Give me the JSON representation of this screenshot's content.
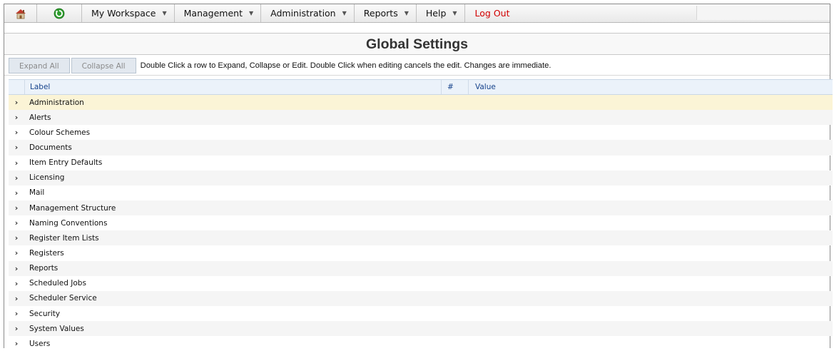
{
  "menubar": {
    "icons": [
      "home-icon",
      "refresh-icon"
    ],
    "items": [
      {
        "label": "My Workspace"
      },
      {
        "label": "Management"
      },
      {
        "label": "Administration"
      },
      {
        "label": "Reports"
      },
      {
        "label": "Help"
      }
    ],
    "logout_label": "Log Out",
    "logout_color": "#d20000",
    "caret_symbol": "▼"
  },
  "page": {
    "title": "Global Settings"
  },
  "toolbar": {
    "expand_all_label": "Expand All",
    "collapse_all_label": "Collapse All",
    "hint": "Double Click a row to Expand, Collapse or Edit. Double Click when editing cancels the edit. Changes are immediate."
  },
  "grid": {
    "columns": {
      "label": "Label",
      "count": "#",
      "value": "Value"
    },
    "expander_symbol": "›",
    "rows": [
      {
        "label": "Administration"
      },
      {
        "label": "Alerts"
      },
      {
        "label": "Colour Schemes"
      },
      {
        "label": "Documents"
      },
      {
        "label": "Item Entry Defaults"
      },
      {
        "label": "Licensing"
      },
      {
        "label": "Mail"
      },
      {
        "label": "Management Structure"
      },
      {
        "label": "Naming Conventions"
      },
      {
        "label": "Register Item Lists"
      },
      {
        "label": "Registers"
      },
      {
        "label": "Reports"
      },
      {
        "label": "Scheduled Jobs"
      },
      {
        "label": "Scheduler Service"
      },
      {
        "label": "Security"
      },
      {
        "label": "System Values"
      },
      {
        "label": "Users"
      }
    ],
    "selected_row_color": "#fbf4d6",
    "header_text_color": "#15428b"
  }
}
